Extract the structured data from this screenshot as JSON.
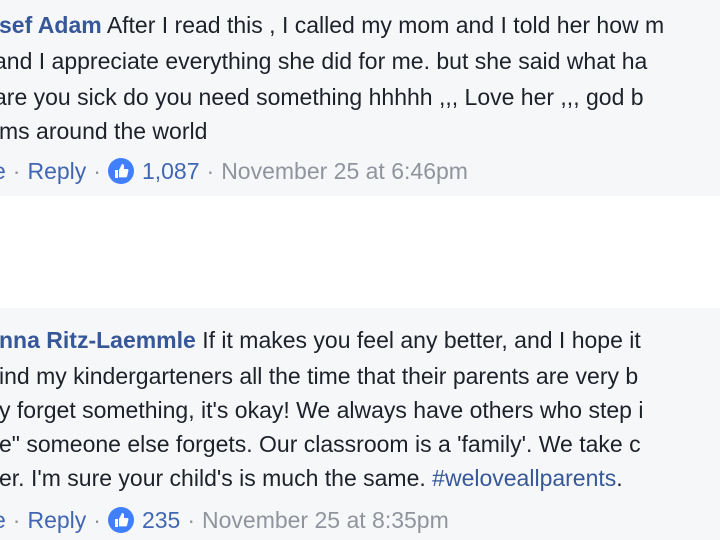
{
  "comments": [
    {
      "author": "sef Adam",
      "lines": [
        "After I read this , I called my mom and I told her how m",
        " and I appreciate everything she did for me. but she said what ha",
        " are you sick do you need something hhhhh ,,, Love her ,,, god b",
        "ms around the world"
      ],
      "actions": {
        "like_fragment": "e",
        "reply": "Reply"
      },
      "like_count": "1,087",
      "timestamp": "November 25 at 6:46pm"
    },
    {
      "author": "nna Ritz-Laemmle",
      "lines": [
        "If it makes you feel any better, and I hope it",
        "ind my kindergarteners all the time that their parents are very b",
        "y forget something, it's okay! We always have others who step i",
        "e\" someone else forgets. Our classroom is a 'family'. We take c",
        "er. I'm sure your child's is much the same."
      ],
      "hashtag": "#weloveallparents",
      "hashtag_suffix": ".",
      "actions": {
        "like_fragment": "e",
        "reply": "Reply"
      },
      "like_count": "235",
      "timestamp": "November 25 at 8:35pm"
    }
  ],
  "separator": "·",
  "colors": {
    "link": "#365899",
    "action": "#4267b2",
    "meta": "#90949c",
    "like_icon": "#4080ff"
  }
}
